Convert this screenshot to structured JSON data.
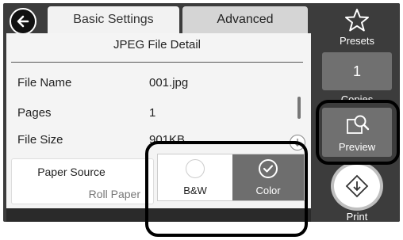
{
  "tabs": [
    {
      "label": "Basic Settings",
      "active": true
    },
    {
      "label": "Advanced",
      "active": false
    }
  ],
  "detail": {
    "title": "JPEG File Detail",
    "rows": [
      {
        "label": "File Name",
        "value": "001.jpg"
      },
      {
        "label": "Pages",
        "value": "1"
      },
      {
        "label": "File Size",
        "value": "901KB"
      }
    ]
  },
  "paper_source": {
    "label": "Paper Source",
    "value": "Roll Paper"
  },
  "color_mode": {
    "options": [
      {
        "label": "B&W",
        "selected": false
      },
      {
        "label": "Color",
        "selected": true
      }
    ]
  },
  "sidebar": {
    "presets_label": "Presets",
    "copies_value": "1",
    "copies_label": "Copies",
    "preview_label": "Preview",
    "print_label": "Print"
  },
  "colors": {
    "panel_bg": "#f4f4f4",
    "frame_bg": "#3c3c3c",
    "button_gray": "#707070",
    "selected_option": "#6e6e6e"
  },
  "icons": [
    "back-arrow-icon",
    "star-icon",
    "preview-zoom-icon",
    "print-diamond-icon",
    "checkmark-icon",
    "scroll-down-icon"
  ]
}
